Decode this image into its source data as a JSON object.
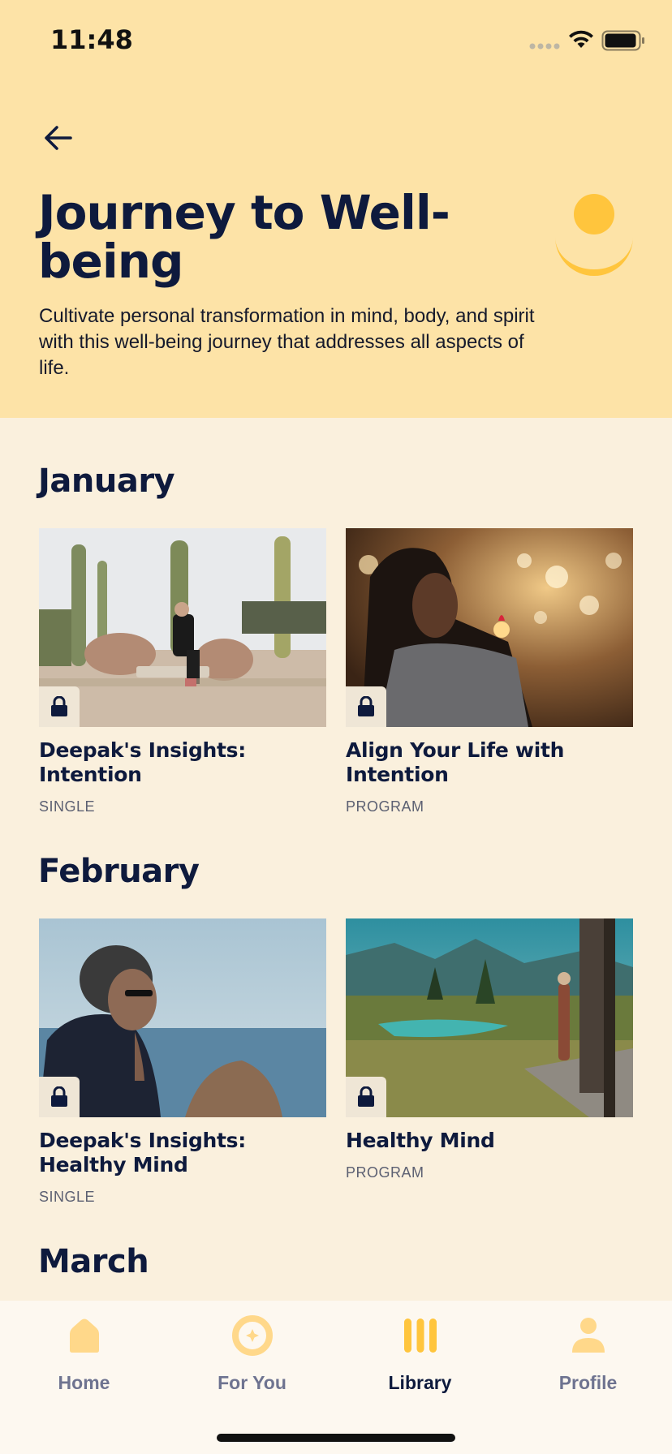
{
  "status_bar": {
    "time": "11:48"
  },
  "header": {
    "title": "Journey to Well-being",
    "description": "Cultivate personal transformation in mind, body, and spirit with this well-being journey that addresses all aspects of life."
  },
  "sections": [
    {
      "title": "January",
      "cards": [
        {
          "title": "Deepak's Insights: Intention",
          "kind": "SINGLE"
        },
        {
          "title": "Align Your Life with Intention",
          "kind": "PROGRAM"
        }
      ]
    },
    {
      "title": "February",
      "cards": [
        {
          "title": "Deepak's Insights: Healthy Mind",
          "kind": "SINGLE"
        },
        {
          "title": "Healthy Mind",
          "kind": "PROGRAM"
        }
      ]
    },
    {
      "title": "March"
    }
  ],
  "tabs": [
    {
      "label": "Home",
      "icon": "home-icon"
    },
    {
      "label": "For You",
      "icon": "for-you-icon"
    },
    {
      "label": "Library",
      "icon": "library-icon",
      "active": true
    },
    {
      "label": "Profile",
      "icon": "profile-icon"
    }
  ],
  "colors": {
    "header_bg": "#FDE3A7",
    "page_bg": "#FAF0DD",
    "accent": "#FFC53D",
    "text_dark": "#0E1A3D"
  }
}
